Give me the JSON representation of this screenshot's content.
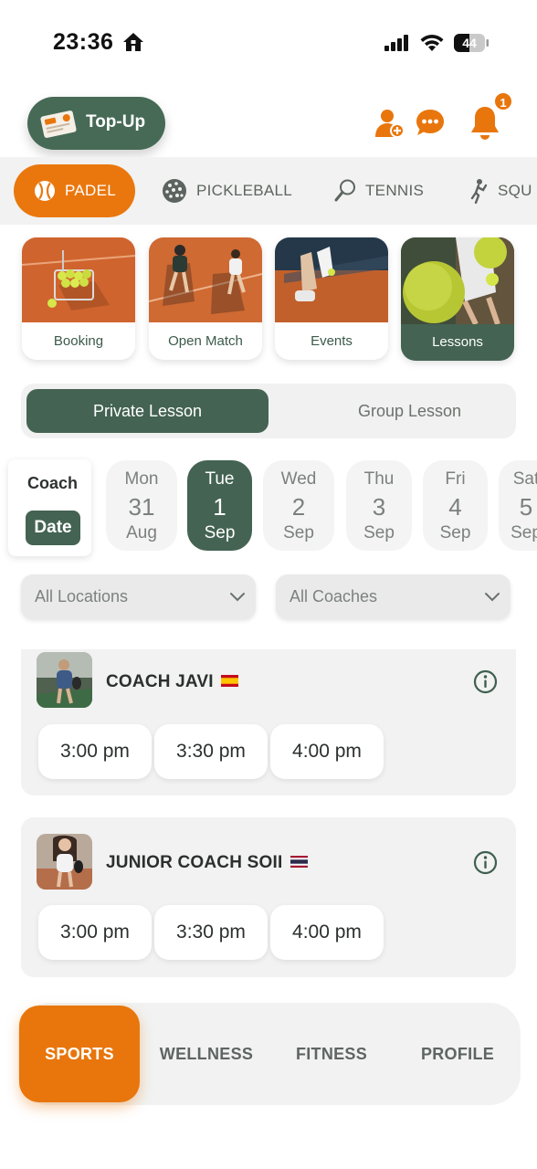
{
  "status_bar": {
    "time": "23:36",
    "battery": "44"
  },
  "header": {
    "topup_label": "Top-Up",
    "notification_count": "1"
  },
  "sports_tabs": [
    {
      "label": "PADEL",
      "icon": "padel-ball-icon",
      "active": true
    },
    {
      "label": "PICKLEBALL",
      "icon": "pickleball-icon",
      "active": false
    },
    {
      "label": "TENNIS",
      "icon": "tennis-racket-icon",
      "active": false
    },
    {
      "label": "SQU",
      "icon": "squash-player-icon",
      "active": false
    }
  ],
  "categories": [
    {
      "label": "Booking",
      "active": false
    },
    {
      "label": "Open Match",
      "active": false
    },
    {
      "label": "Events",
      "active": false
    },
    {
      "label": "Lessons",
      "active": true
    }
  ],
  "lesson_toggle": {
    "private": "Private Lesson",
    "group": "Group Lesson",
    "selected": "Private Lesson"
  },
  "view_toggle": {
    "coach": "Coach",
    "date": "Date"
  },
  "days": [
    {
      "dow": "Mon",
      "num": "31",
      "mon": "Aug",
      "active": false
    },
    {
      "dow": "Tue",
      "num": "1",
      "mon": "Sep",
      "active": true
    },
    {
      "dow": "Wed",
      "num": "2",
      "mon": "Sep",
      "active": false
    },
    {
      "dow": "Thu",
      "num": "3",
      "mon": "Sep",
      "active": false
    },
    {
      "dow": "Fri",
      "num": "4",
      "mon": "Sep",
      "active": false
    },
    {
      "dow": "Sat",
      "num": "5",
      "mon": "Sep",
      "active": false
    }
  ],
  "filters": {
    "locations": "All Locations",
    "coaches": "All Coaches"
  },
  "coaches": [
    {
      "name": "COACH JAVI",
      "flag": "spain-flag-icon",
      "slots": [
        "3:00 pm",
        "3:30 pm",
        "4:00 pm"
      ]
    },
    {
      "name": "JUNIOR COACH SOII",
      "flag": "thailand-flag-icon",
      "slots": [
        "3:00 pm",
        "3:30 pm",
        "4:00 pm"
      ]
    }
  ],
  "bottom_nav": [
    {
      "label": "SPORTS",
      "active": true
    },
    {
      "label": "WELLNESS",
      "active": false
    },
    {
      "label": "FITNESS",
      "active": false
    },
    {
      "label": "PROFILE",
      "active": false
    }
  ],
  "colors": {
    "accent": "#e8760c",
    "brand_green": "#446353",
    "surface": "#f1f2f1"
  }
}
